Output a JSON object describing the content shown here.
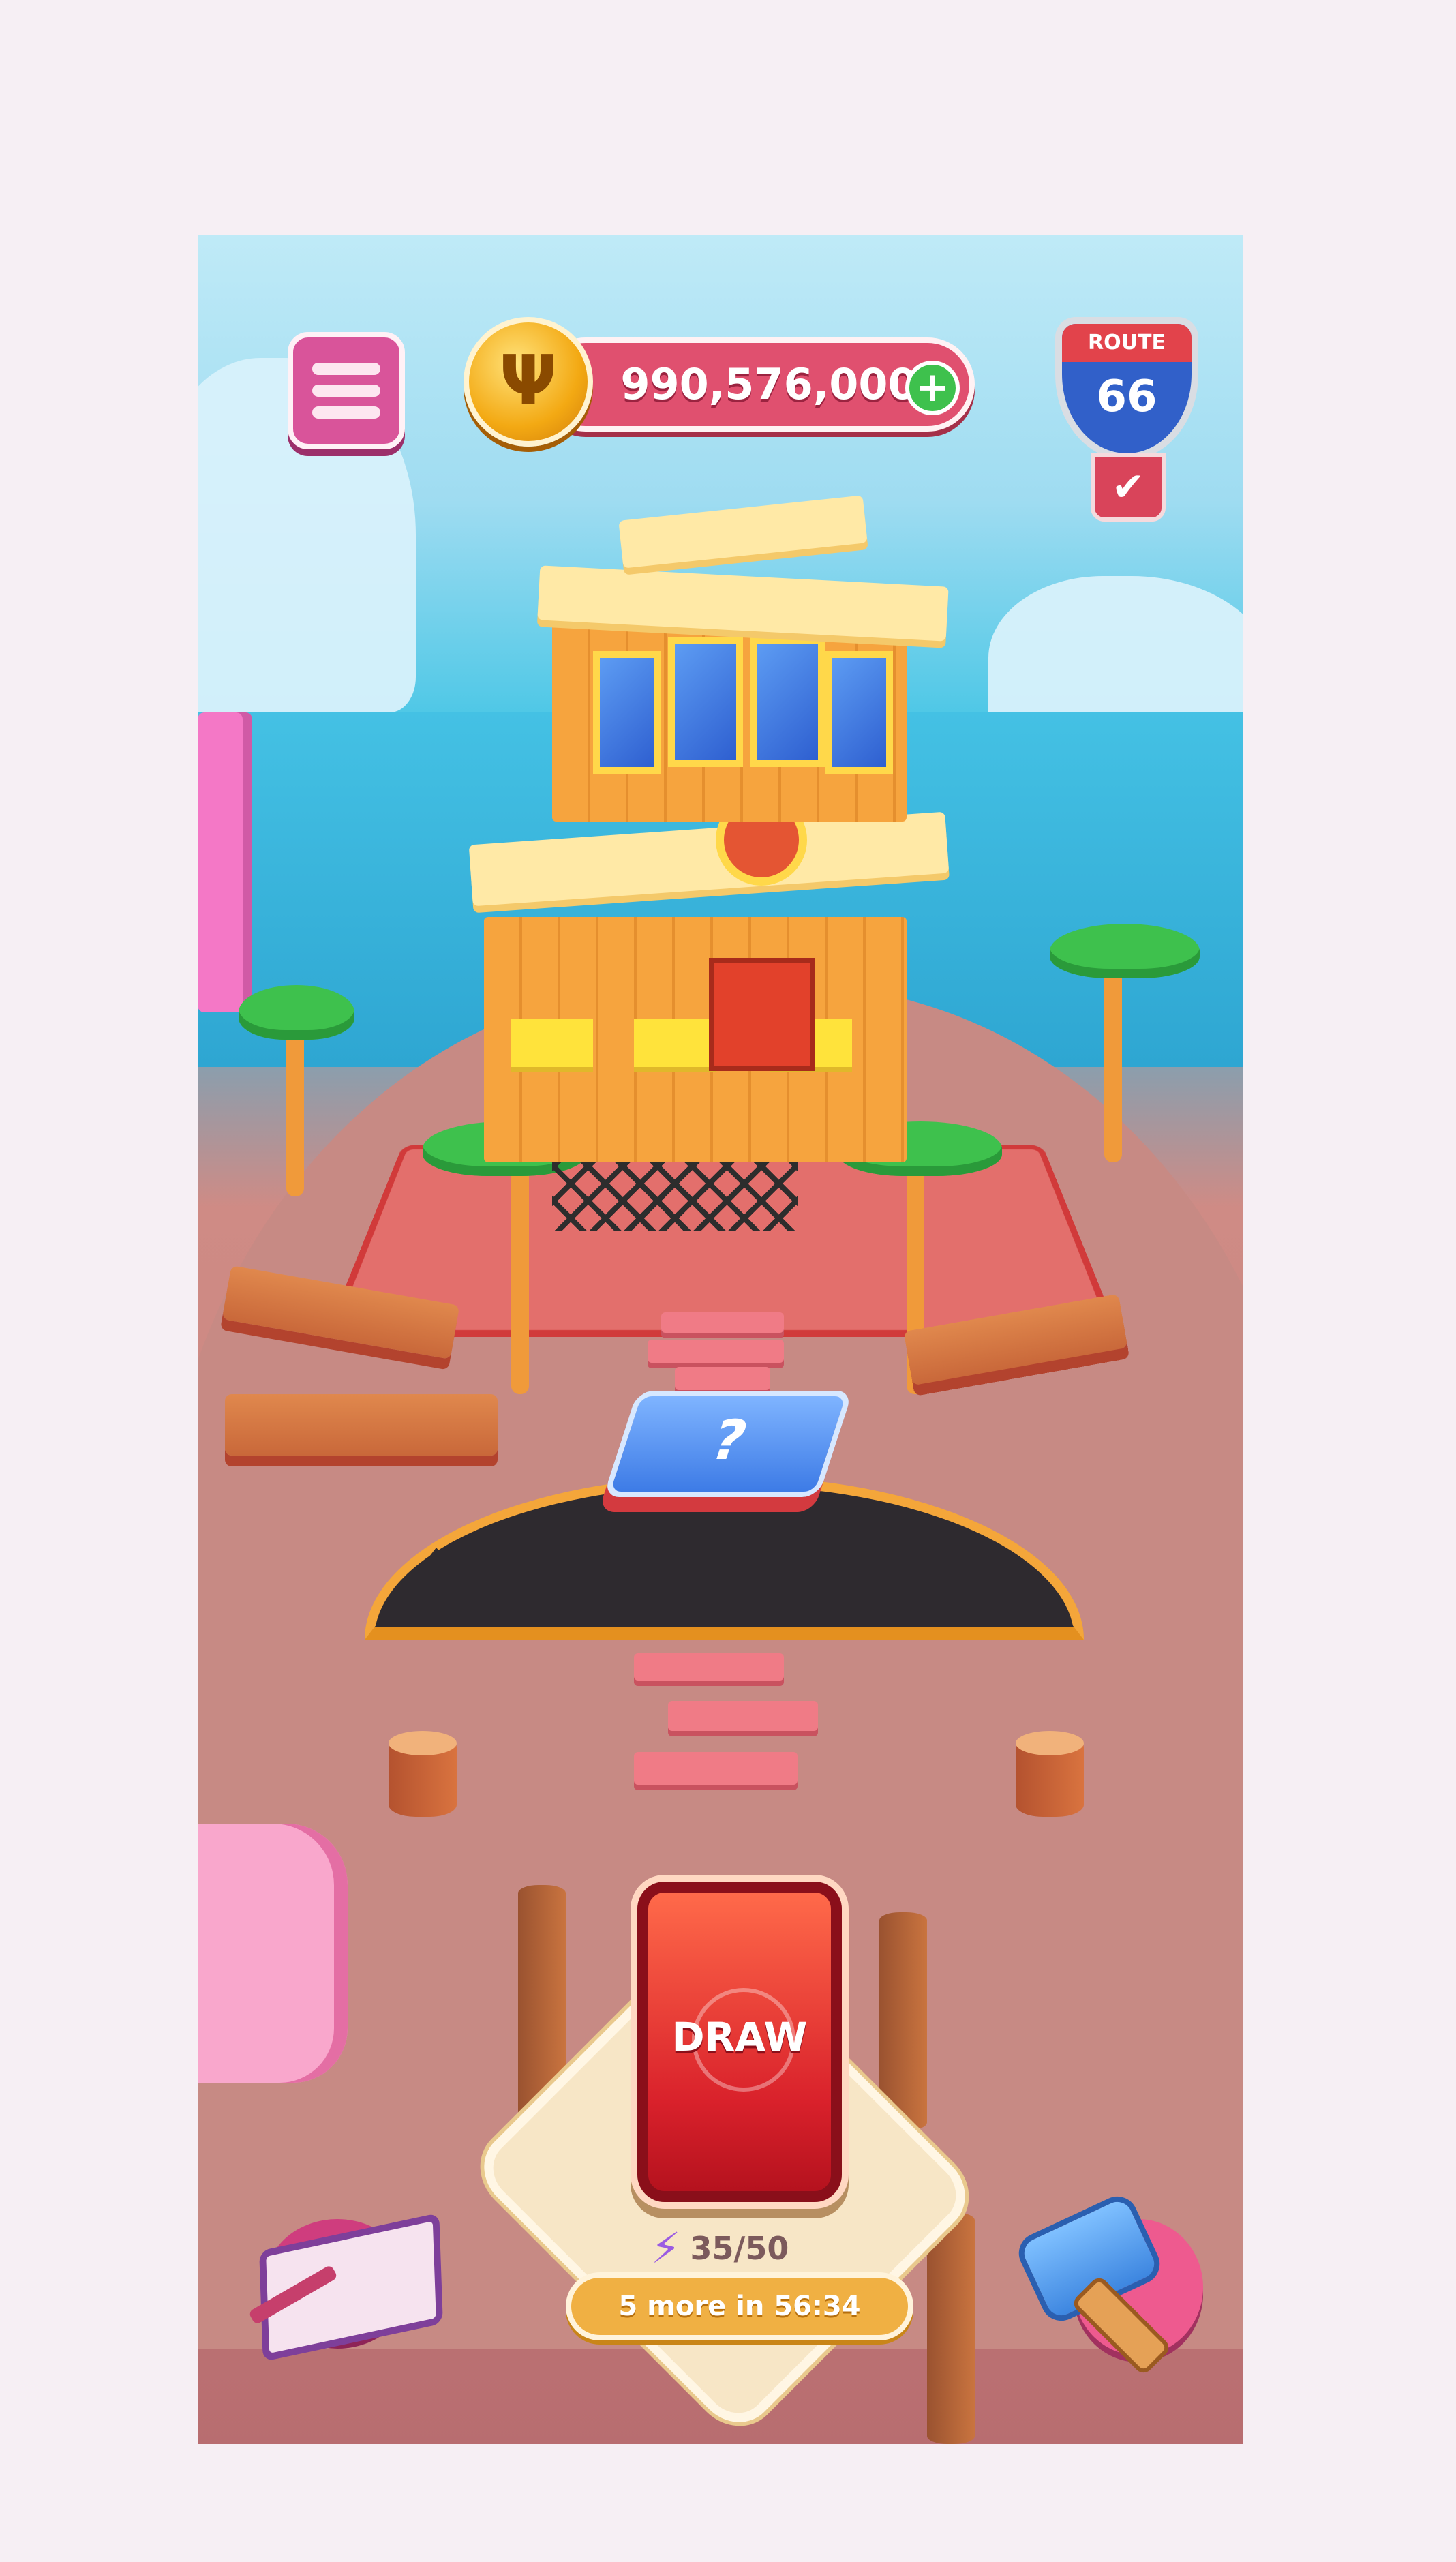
{
  "hud": {
    "coin_amount": "990,576,000",
    "add_coins_symbol": "+",
    "coin_symbol": "Ψ"
  },
  "route_badge": {
    "label": "ROUTE",
    "number": "66",
    "check_symbol": "✔"
  },
  "board": {
    "mystery_card_symbol": "?"
  },
  "draw": {
    "label": "DRAW",
    "energy_icon": "⚡",
    "energy_count": "35/50",
    "refill_text": "5 more in 56:34"
  },
  "icons": {
    "menu": "hamburger-menu-icon",
    "album": "card-album-book-icon",
    "hammer": "hammer-icon"
  },
  "colors": {
    "menu_button": "#d9549a",
    "coin_bar": "#e0506f",
    "add_button": "#3ec14d",
    "draw_button": "#d9212b",
    "refill_pill": "#f0b043"
  }
}
